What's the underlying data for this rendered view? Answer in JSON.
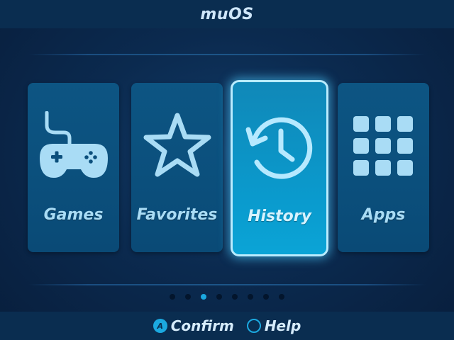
{
  "header": {
    "title": "muOS"
  },
  "menu": {
    "items": [
      {
        "label": "Games",
        "icon": "gamepad-icon",
        "selected": false
      },
      {
        "label": "Favorites",
        "icon": "star-icon",
        "selected": false
      },
      {
        "label": "History",
        "icon": "history-icon",
        "selected": true
      },
      {
        "label": "Apps",
        "icon": "grid-icon",
        "selected": false
      }
    ]
  },
  "pager": {
    "total": 8,
    "current": 3
  },
  "footer": {
    "confirm_button": "A",
    "confirm_label": "Confirm",
    "help_label": "Help"
  },
  "colors": {
    "accent": "#1ba9e0",
    "tile": "#0b4f7c",
    "tile_selected": "#0a9bce",
    "background": "#0b2a4f"
  }
}
